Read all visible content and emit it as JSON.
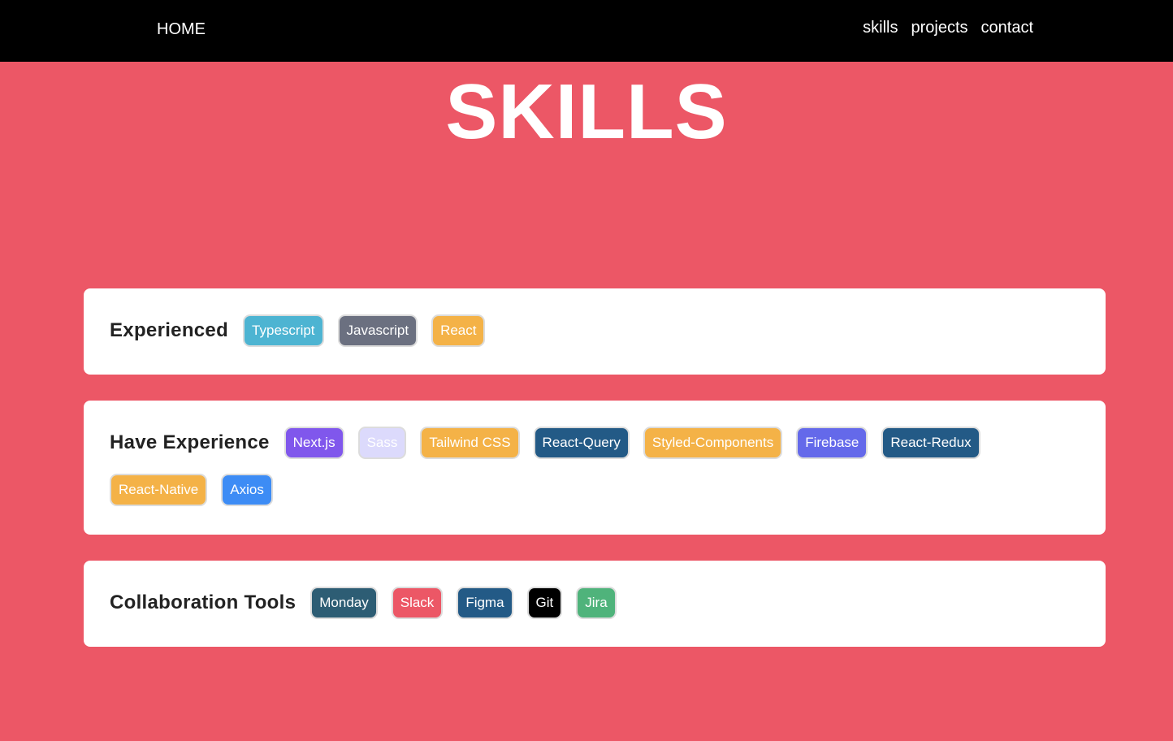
{
  "nav": {
    "home": "HOME",
    "links": [
      "skills",
      "projects",
      "contact"
    ]
  },
  "title": "SKILLS",
  "colors": {
    "page_background": "#ec5766",
    "navbar": "#000000",
    "card": "#ffffff"
  },
  "sections": [
    {
      "title": "Experienced",
      "skills": [
        {
          "label": "Typescript",
          "color": "#4db4d2"
        },
        {
          "label": "Javascript",
          "color": "#6b7080"
        },
        {
          "label": "React",
          "color": "#f4b247"
        }
      ]
    },
    {
      "title": "Have Experience",
      "skills": [
        {
          "label": "Next.js",
          "color": "#8057ec"
        },
        {
          "label": "Sass",
          "color": "#dcdafc"
        },
        {
          "label": "Tailwind CSS",
          "color": "#f4b247"
        },
        {
          "label": "React-Query",
          "color": "#235a86"
        },
        {
          "label": "Styled-Components",
          "color": "#f4b247"
        },
        {
          "label": "Firebase",
          "color": "#6469ea"
        },
        {
          "label": "React-Redux",
          "color": "#235a86"
        },
        {
          "label": "React-Native",
          "color": "#f4b247"
        },
        {
          "label": "Axios",
          "color": "#3d8cf5"
        }
      ]
    },
    {
      "title": "Collaboration Tools",
      "skills": [
        {
          "label": "Monday",
          "color": "#2d5d74"
        },
        {
          "label": "Slack",
          "color": "#ec5766"
        },
        {
          "label": "Figma",
          "color": "#235a86"
        },
        {
          "label": "Git",
          "color": "#000000"
        },
        {
          "label": "Jira",
          "color": "#4fb37b"
        }
      ]
    }
  ]
}
